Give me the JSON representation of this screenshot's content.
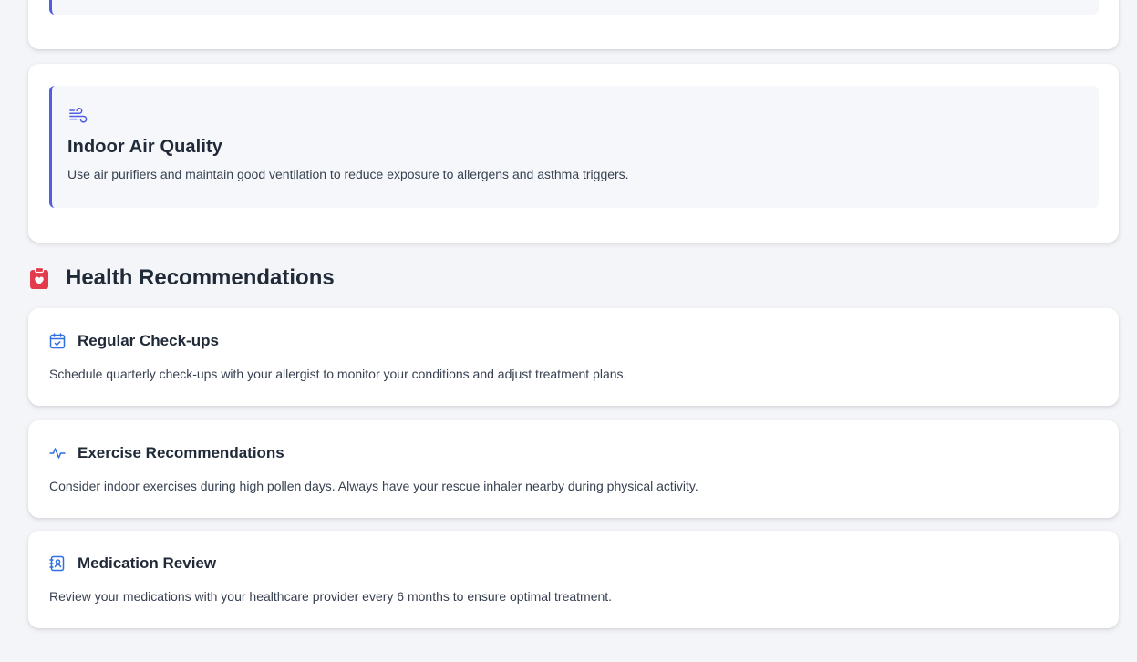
{
  "colors": {
    "accent": "#4f5fe0",
    "health_icon": "#e23b4c",
    "page_background": "#f4f5f8"
  },
  "air_quality_tip": {
    "icon": "wind-icon",
    "title": "Indoor Air Quality",
    "text": "Use air purifiers and maintain good ventilation to reduce exposure to allergens and asthma triggers."
  },
  "health_section": {
    "icon": "clipboard-heart-icon",
    "title": "Health Recommendations",
    "items": [
      {
        "icon": "calendar-check-icon",
        "title": "Regular Check-ups",
        "text": "Schedule quarterly check-ups with your allergist to monitor your conditions and adjust treatment plans."
      },
      {
        "icon": "activity-pulse-icon",
        "title": "Exercise Recommendations",
        "text": "Consider indoor exercises during high pollen days. Always have your rescue inhaler nearby during physical activity."
      },
      {
        "icon": "contact-book-icon",
        "title": "Medication Review",
        "text": "Review your medications with your healthcare provider every 6 months to ensure optimal treatment."
      }
    ]
  }
}
